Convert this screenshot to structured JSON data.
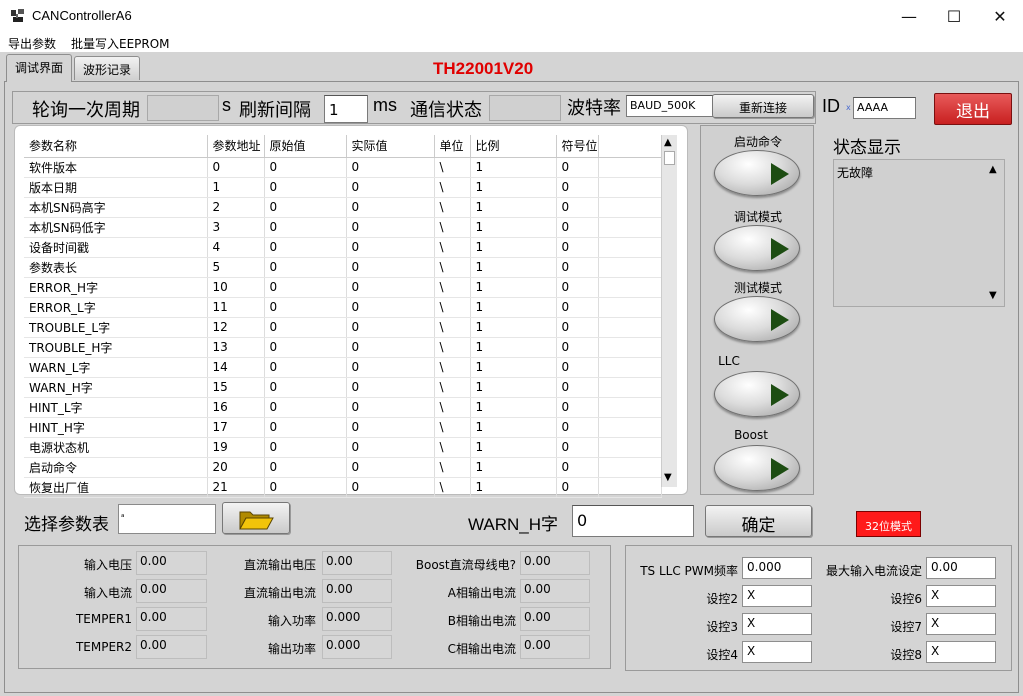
{
  "window": {
    "title": "CANControllerA6",
    "minimize": "—",
    "maximize": "☐",
    "close": "✕"
  },
  "menu": {
    "items": [
      "导出参数",
      "批量写入EEPROM"
    ]
  },
  "tabs": {
    "items": [
      "调试界面",
      "波形记录"
    ],
    "active": 0
  },
  "version": "TH22001V20",
  "top": {
    "poll_label": "轮询一次周期",
    "poll_value": "",
    "poll_unit": "s",
    "refresh_label": "刷新间隔",
    "refresh_value": "1",
    "refresh_unit": "ms",
    "comm_label": "通信状态",
    "comm_value": "",
    "baud_label": "波特率",
    "baud_value": "BAUD_500K",
    "reconnect_label": "重新连接",
    "id_label": "ID",
    "id_prefix": "x",
    "id_value": "AAAA",
    "exit_label": "退出"
  },
  "table": {
    "headers": [
      "参数名称",
      "参数地址",
      "原始值",
      "实际值",
      "单位",
      "比例",
      "符号位"
    ],
    "rows": [
      [
        "软件版本",
        "0",
        "0",
        "0",
        "\\",
        "1",
        "0"
      ],
      [
        "版本日期",
        "1",
        "0",
        "0",
        "\\",
        "1",
        "0"
      ],
      [
        "本机SN码高字",
        "2",
        "0",
        "0",
        "\\",
        "1",
        "0"
      ],
      [
        "本机SN码低字",
        "3",
        "0",
        "0",
        "\\",
        "1",
        "0"
      ],
      [
        "设备时间戳",
        "4",
        "0",
        "0",
        "\\",
        "1",
        "0"
      ],
      [
        "参数表长",
        "5",
        "0",
        "0",
        "\\",
        "1",
        "0"
      ],
      [
        "ERROR_H字",
        "10",
        "0",
        "0",
        "\\",
        "1",
        "0"
      ],
      [
        "ERROR_L字",
        "11",
        "0",
        "0",
        "\\",
        "1",
        "0"
      ],
      [
        "TROUBLE_L字",
        "12",
        "0",
        "0",
        "\\",
        "1",
        "0"
      ],
      [
        "TROUBLE_H字",
        "13",
        "0",
        "0",
        "\\",
        "1",
        "0"
      ],
      [
        "WARN_L字",
        "14",
        "0",
        "0",
        "\\",
        "1",
        "0"
      ],
      [
        "WARN_H字",
        "15",
        "0",
        "0",
        "\\",
        "1",
        "0"
      ],
      [
        "HINT_L字",
        "16",
        "0",
        "0",
        "\\",
        "1",
        "0"
      ],
      [
        "HINT_H字",
        "17",
        "0",
        "0",
        "\\",
        "1",
        "0"
      ],
      [
        "电源状态机",
        "19",
        "0",
        "0",
        "\\",
        "1",
        "0"
      ],
      [
        "启动命令",
        "20",
        "0",
        "0",
        "\\",
        "1",
        "0"
      ],
      [
        "恢复出厂值",
        "21",
        "0",
        "0",
        "\\",
        "1",
        "0"
      ]
    ]
  },
  "commands": [
    {
      "label": "启动命令"
    },
    {
      "label": "调试模式"
    },
    {
      "label": "测试模式"
    },
    {
      "label": "LLC"
    },
    {
      "label": "Boost"
    }
  ],
  "status": {
    "title": "状态显示",
    "text": "无故障"
  },
  "selector": {
    "label": "选择参数表",
    "path_prefix": "ᵃ",
    "path_value": "",
    "field_label": "WARN_H字",
    "field_value": "0",
    "confirm_label": "确定",
    "mode_label": "32位模式"
  },
  "measurements": {
    "col1": [
      {
        "label": "输入电压",
        "value": "0.00"
      },
      {
        "label": "输入电流",
        "value": "0.00"
      },
      {
        "label": "TEMPER1",
        "value": "0.00"
      },
      {
        "label": "TEMPER2",
        "value": "0.00"
      }
    ],
    "col2": [
      {
        "label": "直流输出电压",
        "value": "0.00"
      },
      {
        "label": "直流输出电流",
        "value": "0.00"
      },
      {
        "label": "输入功率",
        "value": "0.000"
      },
      {
        "label": "输出功率",
        "value": "0.000"
      }
    ],
    "col3": [
      {
        "label": "Boost直流母线电?",
        "value": "0.00"
      },
      {
        "label": "A相输出电流",
        "value": "0.00"
      },
      {
        "label": "B相输出电流",
        "value": "0.00"
      },
      {
        "label": "C相输出电流",
        "value": "0.00"
      }
    ]
  },
  "settings": {
    "col1": [
      {
        "label": "TS LLC PWM频率",
        "value": "0.000"
      },
      {
        "label": "设控2",
        "value": "X"
      },
      {
        "label": "设控3",
        "value": "X"
      },
      {
        "label": "设控4",
        "value": "X"
      }
    ],
    "col2": [
      {
        "label": "最大输入电流设定",
        "value": "0.00"
      },
      {
        "label": "设控6",
        "value": "X"
      },
      {
        "label": "设控7",
        "value": "X"
      },
      {
        "label": "设控8",
        "value": "X"
      }
    ]
  }
}
